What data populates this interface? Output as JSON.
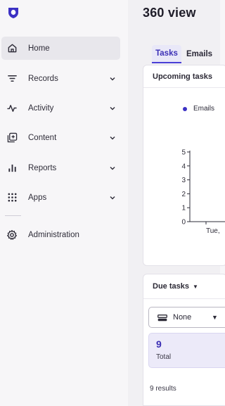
{
  "sidebar": {
    "items": [
      {
        "label": "Home",
        "icon": "home-icon",
        "active": true,
        "expandable": false
      },
      {
        "label": "Records",
        "icon": "filter-lines-icon",
        "active": false,
        "expandable": true
      },
      {
        "label": "Activity",
        "icon": "pulse-icon",
        "active": false,
        "expandable": true
      },
      {
        "label": "Content",
        "icon": "add-content-icon",
        "active": false,
        "expandable": true
      },
      {
        "label": "Reports",
        "icon": "bar-chart-icon",
        "active": false,
        "expandable": true
      },
      {
        "label": "Apps",
        "icon": "grid-dots-icon",
        "active": false,
        "expandable": true
      },
      {
        "label": "Administration",
        "icon": "gear-icon",
        "active": false,
        "expandable": false
      }
    ]
  },
  "main": {
    "title": "360 view",
    "tabs": [
      {
        "label": "Tasks",
        "active": true
      },
      {
        "label": "Emails",
        "active": false
      }
    ],
    "upcoming": {
      "title": "Upcoming tasks",
      "legend": "Emails",
      "chart_data": {
        "type": "bar",
        "categories": [
          "Tue,"
        ],
        "series": [
          {
            "name": "Emails",
            "values": [
              0
            ]
          }
        ],
        "ylim": [
          0,
          5
        ],
        "yticks": [
          "0",
          "1",
          "2",
          "3",
          "4",
          "5"
        ],
        "xlabel": "",
        "ylabel": ""
      }
    },
    "due": {
      "title": "Due tasks",
      "select_value": "None",
      "stat_value": "9",
      "stat_label": "Total",
      "results": "9 results"
    }
  },
  "colors": {
    "accent": "#3b2fb5",
    "active_nav_bg": "#e8e7ec",
    "stat_bg": "#eceaf9"
  }
}
